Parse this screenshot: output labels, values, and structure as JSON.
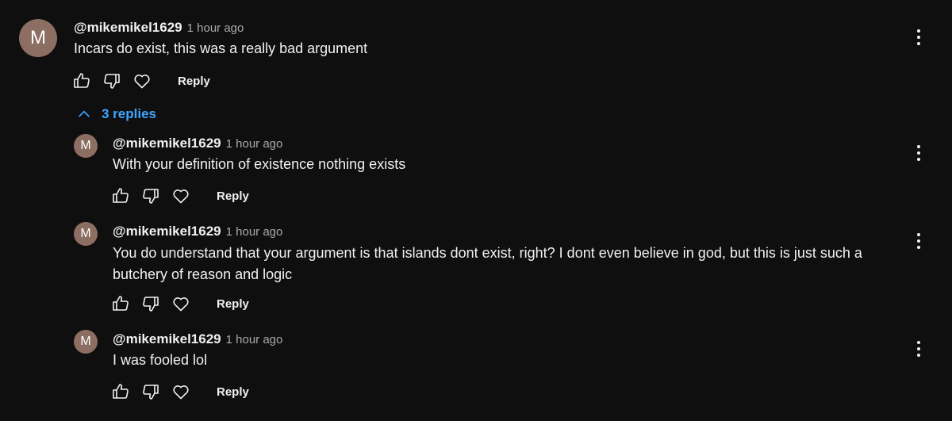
{
  "colors": {
    "background": "#0f0f0f",
    "text": "#f1f1f1",
    "muted": "#aaaaaa",
    "link": "#3ea6ff",
    "avatar": "#8d6e63"
  },
  "top_comment": {
    "avatar_letter": "M",
    "author": "@mikemikel1629",
    "time": "1 hour ago",
    "text": "Incars do exist, this was a really bad argument",
    "reply_label": "Reply"
  },
  "replies_toggle": {
    "label": "3 replies",
    "icon": "chevron-up-icon"
  },
  "replies": [
    {
      "avatar_letter": "M",
      "author": "@mikemikel1629",
      "time": "1 hour ago",
      "text": "With your definition of existence nothing exists",
      "reply_label": "Reply"
    },
    {
      "avatar_letter": "M",
      "author": "@mikemikel1629",
      "time": "1 hour ago",
      "text": "You do understand that your argument is that islands dont exist, right? I dont even believe in god, but this is just such a butchery of reason and logic",
      "reply_label": "Reply"
    },
    {
      "avatar_letter": "M",
      "author": "@mikemikel1629",
      "time": "1 hour ago",
      "text": "I was fooled lol",
      "reply_label": "Reply"
    }
  ]
}
